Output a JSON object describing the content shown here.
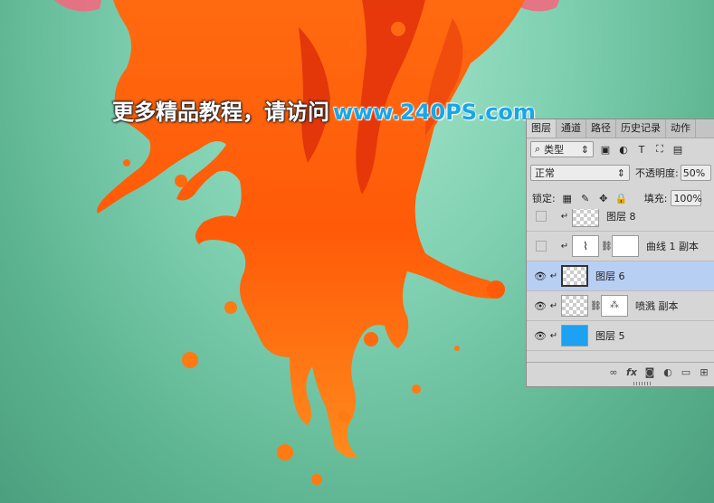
{
  "watermark": {
    "text_cn": "更多精品教程，请访问",
    "url": "www.240PS.com"
  },
  "colors": {
    "bg_top": "#a9e6cc",
    "bg_bottom": "#4c9f7e",
    "splash_dark": "#e23a0d",
    "splash_light": "#ff7a12",
    "panel_bg": "#d6d6d6",
    "selected_row": "#b8cff4",
    "blue_layer": "#1da1f2"
  },
  "panel": {
    "tabs": [
      {
        "label": "图层"
      },
      {
        "label": "通道"
      },
      {
        "label": "路径"
      },
      {
        "label": "历史记录"
      },
      {
        "label": "动作"
      }
    ],
    "filter_kind": "类型",
    "blend_mode": "正常",
    "opacity_label": "不透明度:",
    "opacity_value": "50%",
    "lock_label": "锁定:",
    "fill_label": "填充:",
    "fill_value": "100%",
    "layers": [
      {
        "name": "图层 8",
        "visible": false,
        "thumb": "transparent"
      },
      {
        "name": "曲线 1 副本",
        "visible": false,
        "thumb": "adjustment"
      },
      {
        "name": "图层 6",
        "visible": true,
        "thumb": "transparent",
        "selected": true
      },
      {
        "name": "喷溅 副本",
        "visible": true,
        "thumb": "masked"
      },
      {
        "name": "图层 5",
        "visible": true,
        "thumb": "solid-blue"
      }
    ],
    "footer_icons": [
      "link-icon",
      "fx-icon",
      "mask-icon",
      "adjustment-icon",
      "folder-icon",
      "new-layer-icon"
    ]
  }
}
